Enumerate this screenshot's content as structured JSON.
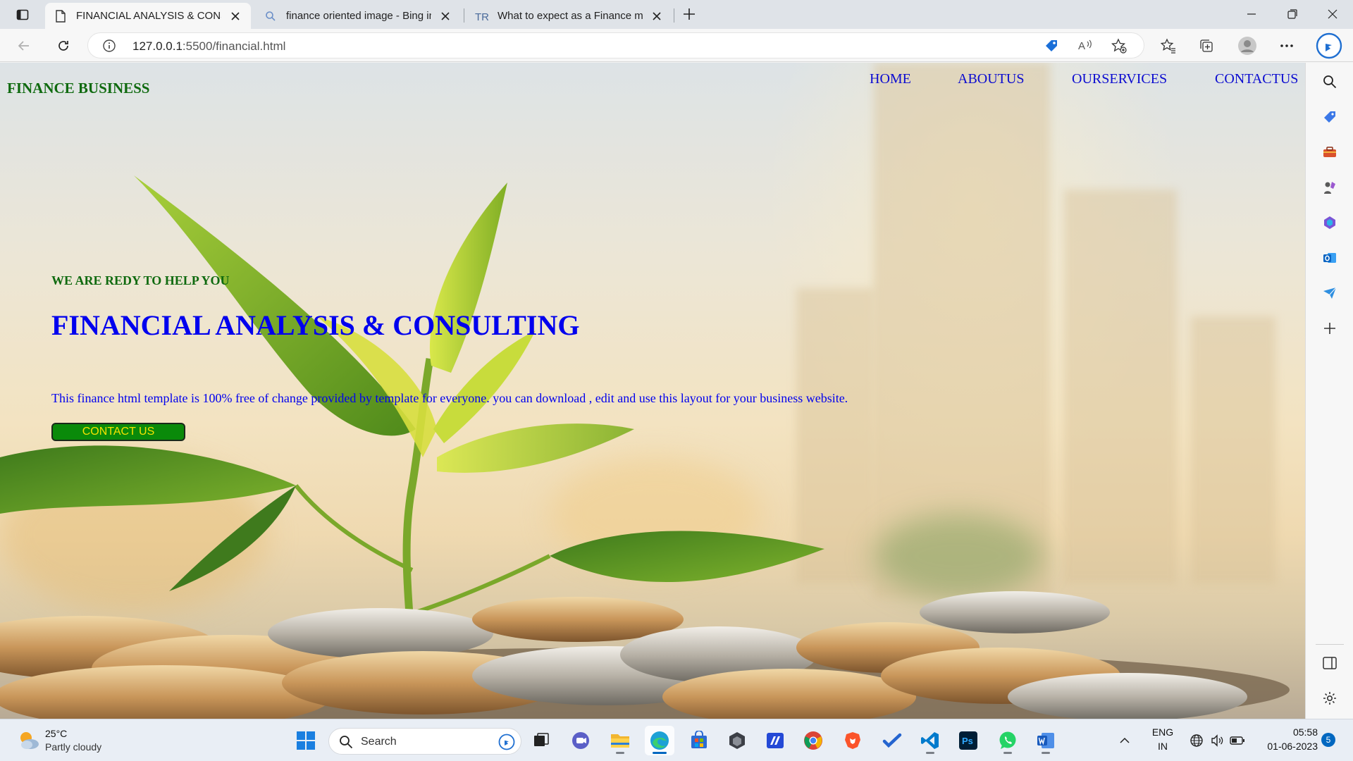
{
  "browser": {
    "tabs": [
      {
        "title": "FINANCIAL ANALYSIS & CONSULTING",
        "favicon": "page-icon",
        "active": true
      },
      {
        "title": "finance oriented image - Bing images",
        "favicon": "search-icon",
        "active": false
      },
      {
        "title": "What to expect as a Finance major",
        "favicon": "tr-icon",
        "active": false
      }
    ],
    "address": {
      "host": "127.0.0.1",
      "path": ":5500/financial.html"
    }
  },
  "page": {
    "brand": "FINANCE BUSINESS",
    "nav": [
      "HOME",
      "ABOUTUS",
      "OURSERVICES",
      "CONTACTUS"
    ],
    "hero": {
      "kicker": "WE ARE REDY TO HELP YOU",
      "title": "FINANCIAL ANALYSIS & CONSULTING",
      "description": "This finance html template is 100% free of change provided by template for everyone. you can download , edit and use this layout for your business website.",
      "button": "CONTACT US"
    },
    "colors": {
      "brand": "#0f6a0f",
      "link": "#0000ee",
      "button_bg": "#0a8a0a",
      "button_text": "#f5e300"
    }
  },
  "sidebar": {
    "icons": [
      "search-icon",
      "tag-icon",
      "toolbox-icon",
      "games-icon",
      "m365-icon",
      "outlook-icon",
      "send-icon",
      "add-icon",
      "split-screen-icon",
      "settings-icon"
    ]
  },
  "taskbar": {
    "weather": {
      "temp": "25°C",
      "desc": "Partly cloudy"
    },
    "search_placeholder": "Search",
    "apps": [
      "windows-start-icon",
      "task-view-icon",
      "teams-icon",
      "file-explorer-icon",
      "edge-icon",
      "store-icon",
      "dev-icon",
      "editor-icon",
      "chrome-icon",
      "brave-icon",
      "todo-icon",
      "vscode-icon",
      "photoshop-icon",
      "whatsapp-icon",
      "word-icon"
    ],
    "tray": {
      "lang_top": "ENG",
      "lang_bottom": "IN",
      "time": "05:58",
      "date": "01-06-2023",
      "notifications": "5"
    }
  }
}
